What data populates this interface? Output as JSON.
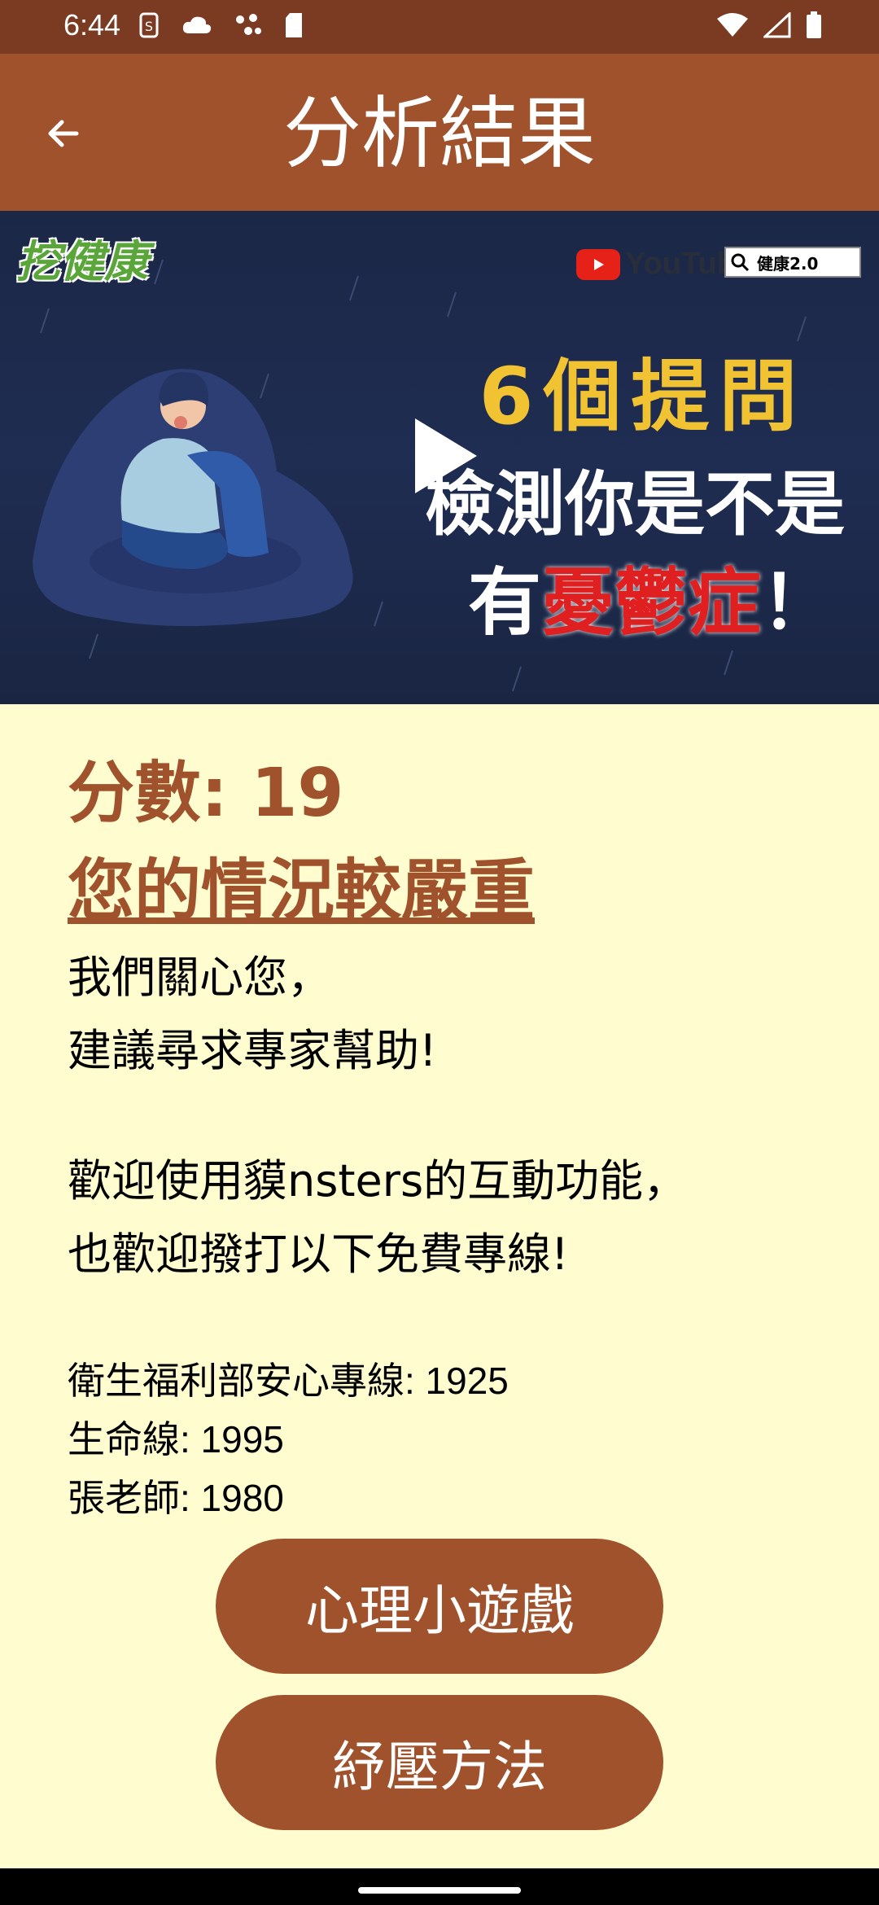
{
  "status_bar": {
    "time": "6:44",
    "left_icons": [
      "sim-icon",
      "cloud-icon",
      "dots-icon",
      "sd-card-icon"
    ],
    "right_icons": [
      "wifi-icon",
      "signal-icon",
      "battery-icon"
    ]
  },
  "app_bar": {
    "title": "分析結果",
    "back_icon": "arrow-left-icon"
  },
  "video": {
    "logo_text": "挖健康",
    "yt_wordmark": "YouTube",
    "search_text": "健康2.0",
    "line1": "6個提問",
    "line2": "檢測你是不是",
    "line3_prefix": "有",
    "line3_highlight": "憂鬱症",
    "line3_suffix": "！",
    "colors": {
      "line1": "#f1c232",
      "highlight": "#e02020"
    }
  },
  "result": {
    "score": "分數: 19",
    "severity": "您的情況較嚴重",
    "msg_line1": "我們關心您，",
    "msg_line2": "建議尋求專家幫助!",
    "msg_line3": "歡迎使用貘nsters的互動功能，",
    "msg_line4": "也歡迎撥打以下免費專線!"
  },
  "hotlines": [
    "衛生福利部安心專線: 1925",
    "生命線: 1995",
    "張老師: 1980"
  ],
  "buttons": {
    "game": "心理小遊戲",
    "relief": "紓壓方法"
  },
  "colors": {
    "accent": "#A0522D",
    "status_bar": "#7a3b22",
    "background": "#FFFDD0"
  }
}
